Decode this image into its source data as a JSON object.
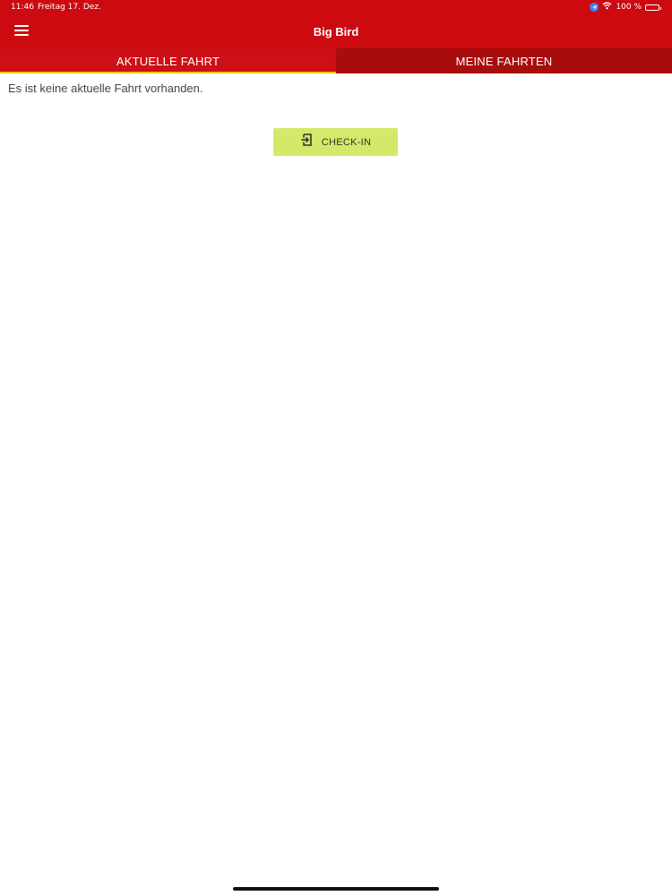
{
  "status_bar": {
    "time": "11:46",
    "date": "Freitag 17. Dez.",
    "battery": "100 %"
  },
  "app_bar": {
    "title": "Big Bird"
  },
  "tabs": [
    {
      "label": "AKTUELLE FAHRT",
      "active": true
    },
    {
      "label": "MEINE FAHRTEN",
      "active": false
    }
  ],
  "content": {
    "empty_message": "Es ist keine aktuelle Fahrt vorhanden.",
    "checkin_label": "CHECK-IN"
  },
  "colors": {
    "primary": "#cc0a10",
    "tab_bar": "#a80d0d",
    "tab_indicator": "#f5c518",
    "checkin_button": "#d4e86a"
  },
  "icons": {
    "menu": "menu-icon",
    "checkin": "login-icon",
    "location": "location-icon",
    "wifi": "wifi-icon",
    "battery": "battery-icon"
  }
}
